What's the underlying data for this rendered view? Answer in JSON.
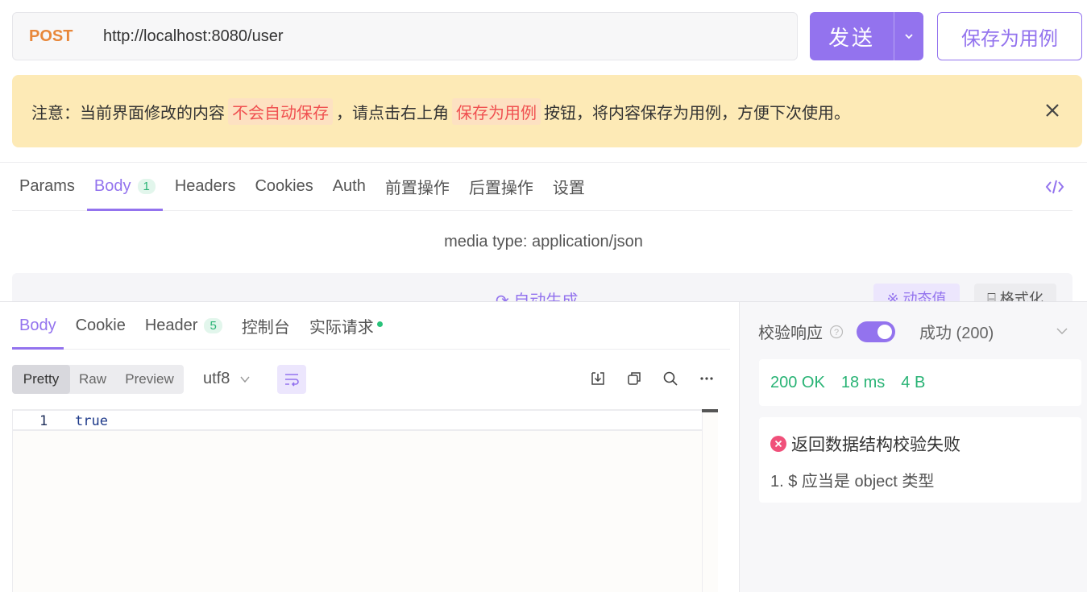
{
  "request": {
    "method": "POST",
    "url": "http://localhost:8080/user",
    "send_label": "发送",
    "save_case_label": "保存为用例"
  },
  "notice": {
    "prefix": "注意：当前界面修改的内容",
    "highlight1": "不会自动保存",
    "middle": "，请点击右上角",
    "highlight2": "保存为用例",
    "suffix": "按钮，将内容保存为用例，方便下次使用。"
  },
  "request_tabs": [
    {
      "label": "Params"
    },
    {
      "label": "Body",
      "badge": "1"
    },
    {
      "label": "Headers"
    },
    {
      "label": "Cookies"
    },
    {
      "label": "Auth"
    },
    {
      "label": "前置操作"
    },
    {
      "label": "后置操作"
    },
    {
      "label": "设置"
    }
  ],
  "body": {
    "media_type": "media type: application/json",
    "auto_generate": "自动生成",
    "dynamic_value": "动态值",
    "format": "格式化"
  },
  "response_tabs": [
    {
      "label": "Body"
    },
    {
      "label": "Cookie"
    },
    {
      "label": "Header",
      "badge": "5"
    },
    {
      "label": "控制台"
    },
    {
      "label": "实际请求"
    }
  ],
  "view_modes": [
    "Pretty",
    "Raw",
    "Preview"
  ],
  "encoding": "utf8",
  "code": {
    "line_number": "1",
    "text": "true"
  },
  "validation": {
    "label": "校验响应",
    "status": "成功 (200)"
  },
  "stats": {
    "status": "200 OK",
    "time": "18 ms",
    "size": "4 B"
  },
  "error": {
    "title": "返回数据结构校验失败",
    "detail": "1. $ 应当是 object 类型"
  },
  "colors": {
    "accent": "#9373ee",
    "method": "#e8873a",
    "success": "#29b375",
    "warning_bg": "#fdeab6",
    "highlight": "#f05050",
    "error": "#f0507a"
  }
}
